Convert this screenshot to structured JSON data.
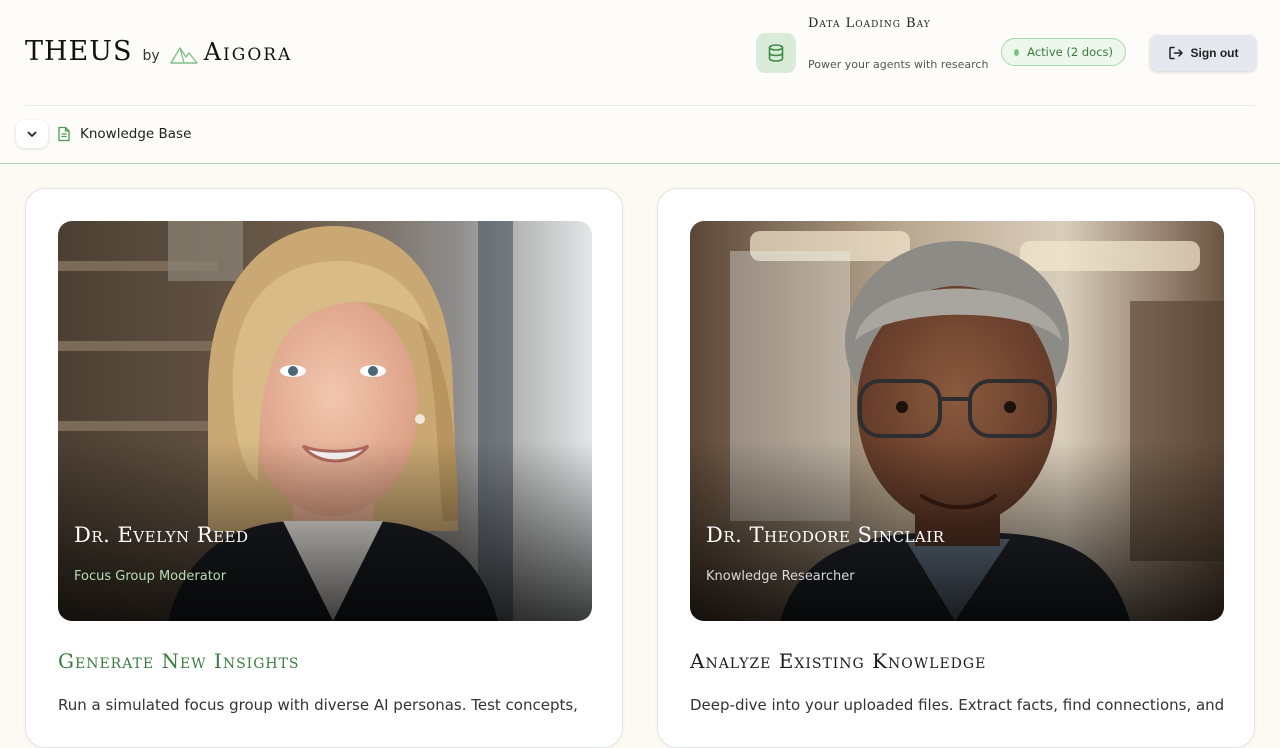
{
  "brand": {
    "name": "THEUS",
    "by": "by",
    "company": "Aigora"
  },
  "data_bay": {
    "title": "Data Loading Bay",
    "subtitle": "Power your agents with research",
    "icon": "database-icon"
  },
  "status": {
    "label": "Active (2 docs)",
    "color": "#7cc482"
  },
  "signout": {
    "label": "Sign out",
    "icon": "sign-out-icon"
  },
  "knowledge_base": {
    "label": "Knowledge Base",
    "toggle_icon": "chevron-down-icon",
    "doc_icon": "document-icon"
  },
  "cards": [
    {
      "name": "Dr. Evelyn Reed",
      "role": "Focus Group Moderator",
      "title": "Generate New Insights",
      "description": "Run a simulated focus group with diverse AI personas. Test concepts,"
    },
    {
      "name": "Dr. Theodore Sinclair",
      "role": "Knowledge Researcher",
      "title": "Analyze Existing Knowledge",
      "description": "Deep-dive into your uploaded files. Extract facts, find connections, and"
    }
  ],
  "colors": {
    "accent_green": "#3b7d3f",
    "background": "#fcfaf3"
  }
}
